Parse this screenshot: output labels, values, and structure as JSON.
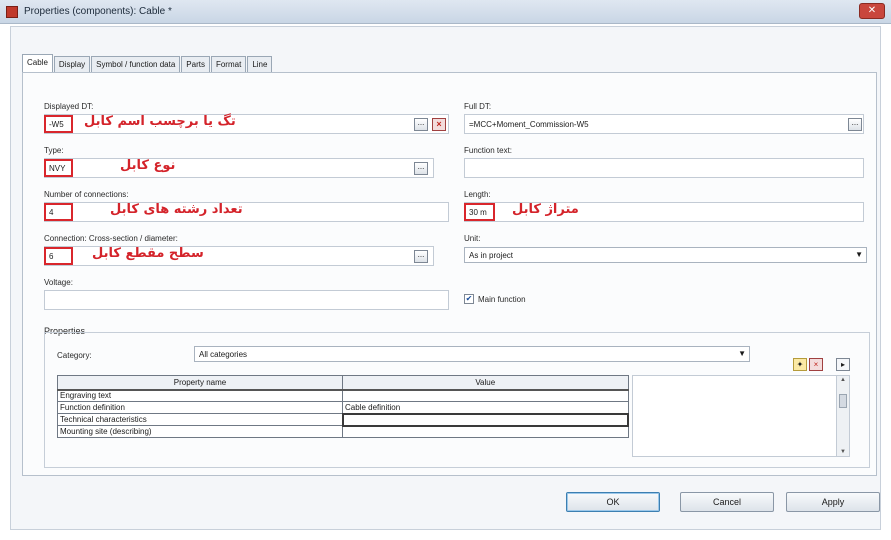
{
  "window": {
    "title": "Properties (components): Cable *"
  },
  "tabs": [
    {
      "label": "Cable"
    },
    {
      "label": "Display"
    },
    {
      "label": "Symbol / function data"
    },
    {
      "label": "Parts"
    },
    {
      "label": "Format"
    },
    {
      "label": "Line"
    }
  ],
  "fields": {
    "displayed_dt": {
      "label": "Displayed DT:",
      "value": "-W5",
      "annotation": "تگ یا برچسب اسم کابل"
    },
    "full_dt": {
      "label": "Full DT:",
      "value": "=MCC+Moment_Commission-W5"
    },
    "type": {
      "label": "Type:",
      "value": "NVY",
      "annotation": "نوع کابل"
    },
    "function_text": {
      "label": "Function text:",
      "value": ""
    },
    "num_connections": {
      "label": "Number of connections:",
      "value": "4",
      "annotation": "تعداد رشته های کابل"
    },
    "length": {
      "label": "Length:",
      "value": "30 m",
      "annotation": "متراژ کابل"
    },
    "cross_section": {
      "label": "Connection: Cross-section / diameter:",
      "value": "6",
      "annotation": "سطح مقطع کابل"
    },
    "unit": {
      "label": "Unit:",
      "value": "As in project"
    },
    "voltage": {
      "label": "Voltage:",
      "value": ""
    },
    "main_function": {
      "label": "Main function",
      "checked": true
    }
  },
  "properties": {
    "group_label": "Properties",
    "category_label": "Category:",
    "category_value": "All categories",
    "columns": [
      "Property name",
      "Value"
    ],
    "rows": [
      {
        "name": "Engraving text",
        "value": ""
      },
      {
        "name": "Function definition",
        "value": "Cable definition"
      },
      {
        "name": "Technical characteristics",
        "value": ""
      },
      {
        "name": "Mounting site (describing)",
        "value": ""
      }
    ]
  },
  "buttons": {
    "ok": "OK",
    "cancel": "Cancel",
    "apply": "Apply",
    "ellipsis": "...",
    "clear": "×"
  },
  "colors": {
    "annotation": "#d4232a",
    "accent": "#3c7fb1"
  }
}
